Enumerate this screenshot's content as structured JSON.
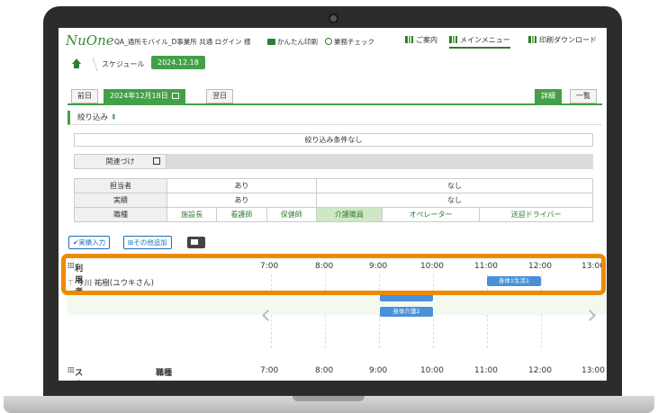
{
  "header": {
    "logo": "NuOne",
    "office": "QA_通所モバイル_D事業所 共通 ログイン 様",
    "print_label": "かんたん印刷",
    "check_label": "業務チェック",
    "nav": [
      "ご案内",
      "メインメニュー",
      "印刷ダウンロード"
    ]
  },
  "breadcrumb": {
    "page": "スケジュール",
    "date": "2024.12.18"
  },
  "date_nav": {
    "prev": "前日",
    "current": "2024年12月18日",
    "next": "翌日"
  },
  "view_tabs": [
    "詳細",
    "一覧"
  ],
  "filter": {
    "title": "絞り込み",
    "condition": "絞り込み条件なし",
    "relation_label": "関連づけ",
    "rows": [
      {
        "label": "担当者",
        "values": [
          "あり",
          "なし"
        ]
      },
      {
        "label": "実績",
        "values": [
          "あり",
          "なし"
        ]
      }
    ],
    "job_label": "職種",
    "jobs": [
      "施設長",
      "看護師",
      "保健師",
      "介護職員",
      "オペレーター",
      "送迎ドライバー"
    ],
    "selected_job": "介護職員"
  },
  "actions": {
    "record": "実績入力",
    "add_other": "その他追加"
  },
  "schedule": {
    "users_label": "利用者",
    "staff_label": "スタッフ",
    "job_col": "職種",
    "times": [
      "7:00",
      "8:00",
      "9:00",
      "10:00",
      "11:00",
      "12:00",
      "13:00"
    ],
    "user_name": "今川 祐樹(ユウキさん)",
    "events": [
      "身体1生活1",
      "身体介護2"
    ]
  },
  "colors": {
    "accent": "#43a047",
    "event": "#4a90d9",
    "highlight": "#ef8a00"
  }
}
